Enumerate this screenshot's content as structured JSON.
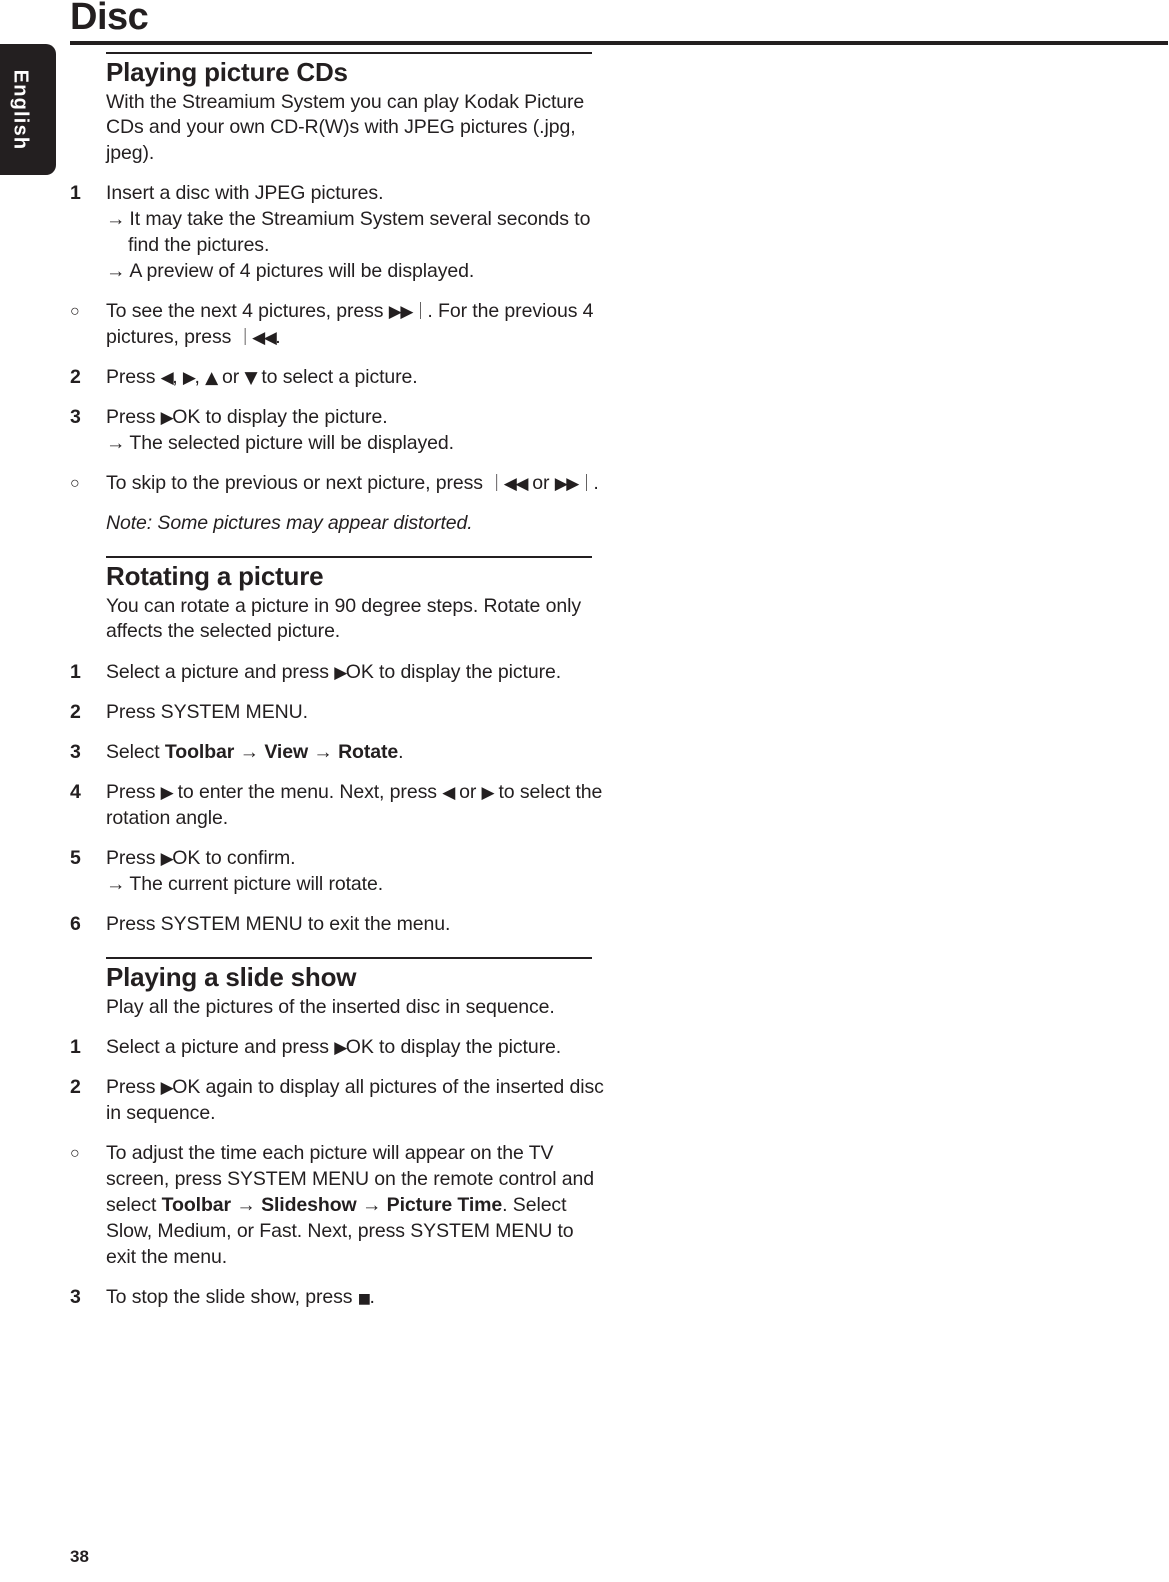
{
  "page": {
    "title": "Disc",
    "language_tab": "English",
    "page_number": "38"
  },
  "glyphs": {
    "next": "▶▶｜",
    "previous": "｜◀◀",
    "play_ok": "▶",
    "left": "◀",
    "right": "▶",
    "up": "▲",
    "down": "▼",
    "stop": "■",
    "result_arrow": "→",
    "menu_arrow": "→"
  },
  "sections": [
    {
      "heading": "Playing picture CDs",
      "intro": "With the Streamium System you can play Kodak Picture CDs and your own CD-R(W)s with JPEG pictures (.jpg, jpeg).",
      "steps": [
        {
          "marker": "1",
          "marker_type": "number",
          "text": "Insert a disc with JPEG pictures.",
          "results": [
            "It may take the Streamium System several seconds to find the pictures.",
            "A preview of 4 pictures will be displayed."
          ]
        },
        {
          "marker": "○",
          "marker_type": "bullet",
          "text_parts": [
            {
              "t": "To see the next 4 pictures, press "
            },
            {
              "t": "▶▶｜",
              "style": "glyph"
            },
            {
              "t": ". For the previous 4 pictures, press "
            },
            {
              "t": "｜◀◀",
              "style": "glyph"
            },
            {
              "t": "."
            }
          ]
        },
        {
          "marker": "2",
          "marker_type": "number",
          "text_parts": [
            {
              "t": "Press "
            },
            {
              "t": "◀",
              "style": "glyph"
            },
            {
              "t": ", "
            },
            {
              "t": "▶",
              "style": "glyph"
            },
            {
              "t": ", "
            },
            {
              "t": "▲",
              "style": "glyph"
            },
            {
              "t": " or "
            },
            {
              "t": "▼",
              "style": "glyph"
            },
            {
              "t": " to select a picture."
            }
          ]
        },
        {
          "marker": "3",
          "marker_type": "number",
          "text_parts": [
            {
              "t": "Press "
            },
            {
              "t": "▶",
              "style": "glyph"
            },
            {
              "t": "OK to display the picture."
            }
          ],
          "results": [
            "The selected picture will be displayed."
          ]
        },
        {
          "marker": "○",
          "marker_type": "bullet",
          "text_parts": [
            {
              "t": "To skip to the previous or next picture, press "
            },
            {
              "t": "｜◀◀",
              "style": "glyph"
            },
            {
              "t": " or "
            },
            {
              "t": "▶▶｜",
              "style": "glyph"
            },
            {
              "t": "."
            }
          ]
        },
        {
          "marker": "",
          "marker_type": "none",
          "note": true,
          "text": "Note: Some pictures may appear distorted."
        }
      ]
    },
    {
      "heading": "Rotating a picture",
      "intro": "You can rotate a picture in 90 degree steps. Rotate only affects the selected picture.",
      "steps": [
        {
          "marker": "1",
          "marker_type": "number",
          "text_parts": [
            {
              "t": "Select a picture and press "
            },
            {
              "t": "▶",
              "style": "glyph"
            },
            {
              "t": "OK to display the picture."
            }
          ]
        },
        {
          "marker": "2",
          "marker_type": "number",
          "text": "Press SYSTEM MENU."
        },
        {
          "marker": "3",
          "marker_type": "number",
          "text_parts": [
            {
              "t": "Select "
            },
            {
              "t": "Toolbar",
              "style": "bold"
            },
            {
              "t": " → ",
              "style": "menu-arrow"
            },
            {
              "t": "View",
              "style": "bold"
            },
            {
              "t": " → ",
              "style": "menu-arrow"
            },
            {
              "t": "Rotate",
              "style": "bold"
            },
            {
              "t": "."
            }
          ]
        },
        {
          "marker": "4",
          "marker_type": "number",
          "text_parts": [
            {
              "t": "Press "
            },
            {
              "t": "▶",
              "style": "glyph"
            },
            {
              "t": " to enter the menu. Next, press "
            },
            {
              "t": "◀",
              "style": "glyph"
            },
            {
              "t": " or "
            },
            {
              "t": "▶",
              "style": "glyph"
            },
            {
              "t": " to select the rotation angle."
            }
          ]
        },
        {
          "marker": "5",
          "marker_type": "number",
          "text_parts": [
            {
              "t": "Press "
            },
            {
              "t": "▶",
              "style": "glyph"
            },
            {
              "t": "OK to confirm."
            }
          ],
          "results": [
            "The current picture will rotate."
          ]
        },
        {
          "marker": "6",
          "marker_type": "number",
          "text": "Press SYSTEM MENU to exit the menu."
        }
      ]
    },
    {
      "heading": "Playing a slide show",
      "intro": "Play all the pictures of the inserted disc in sequence.",
      "steps": [
        {
          "marker": "1",
          "marker_type": "number",
          "text_parts": [
            {
              "t": "Select a picture and press "
            },
            {
              "t": "▶",
              "style": "glyph"
            },
            {
              "t": "OK to display the picture."
            }
          ]
        },
        {
          "marker": "2",
          "marker_type": "number",
          "text_parts": [
            {
              "t": "Press "
            },
            {
              "t": "▶",
              "style": "glyph"
            },
            {
              "t": "OK again to display all pictures of the inserted disc in sequence."
            }
          ]
        },
        {
          "marker": "○",
          "marker_type": "bullet",
          "text_parts": [
            {
              "t": "To adjust the time each picture will appear on the TV screen, press SYSTEM MENU on the remote control and select "
            },
            {
              "t": "Toolbar",
              "style": "bold"
            },
            {
              "t": " → ",
              "style": "menu-arrow"
            },
            {
              "t": "Slideshow",
              "style": "bold"
            },
            {
              "t": " → ",
              "style": "menu-arrow"
            },
            {
              "t": "Picture Time",
              "style": "bold"
            },
            {
              "t": ". Select Slow, Medium, or Fast. Next, press SYSTEM MENU to exit the menu."
            }
          ]
        },
        {
          "marker": "3",
          "marker_type": "number",
          "text_parts": [
            {
              "t": "To stop the slide show, press "
            },
            {
              "t": "■",
              "style": "glyph-stop"
            },
            {
              "t": "."
            }
          ]
        }
      ]
    }
  ]
}
